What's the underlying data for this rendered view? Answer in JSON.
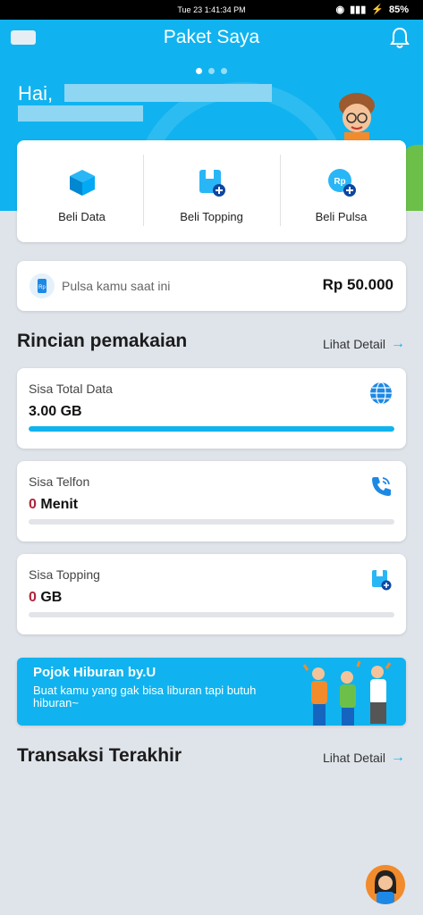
{
  "status_bar": {
    "time": "Tue 23 1:41:34 PM",
    "battery": "85%"
  },
  "header": {
    "title": "Paket Saya",
    "greeting": "Hai,",
    "carousel_pages": 3,
    "carousel_active": 1
  },
  "quick_actions": [
    {
      "label": "Beli Data",
      "icon": "cube-icon"
    },
    {
      "label": "Beli Topping",
      "icon": "topping-icon"
    },
    {
      "label": "Beli Pulsa",
      "icon": "pulsa-icon"
    }
  ],
  "balance": {
    "label": "Pulsa kamu saat ini",
    "value": "Rp 50.000"
  },
  "usage_section": {
    "title": "Rincian pemakaian",
    "link": "Lihat Detail",
    "items": [
      {
        "label": "Sisa Total Data",
        "amount": "3.00",
        "unit": "GB",
        "progress": 1.0,
        "icon": "globe-icon"
      },
      {
        "label": "Sisa Telfon",
        "amount": "0",
        "unit": "Menit",
        "progress": 0,
        "icon": "phone-icon"
      },
      {
        "label": "Sisa Topping",
        "amount": "0",
        "unit": "GB",
        "progress": 0,
        "icon": "topping-icon"
      }
    ]
  },
  "banner": {
    "title": "Pojok Hiburan by.U",
    "subtitle": "Buat kamu yang gak bisa liburan tapi butuh hiburan~"
  },
  "transactions_section": {
    "title": "Transaksi Terakhir",
    "link": "Lihat Detail"
  },
  "colors": {
    "accent": "#10b3ef",
    "amount_highlight": "#b0243b",
    "background": "#dfe4ea"
  }
}
